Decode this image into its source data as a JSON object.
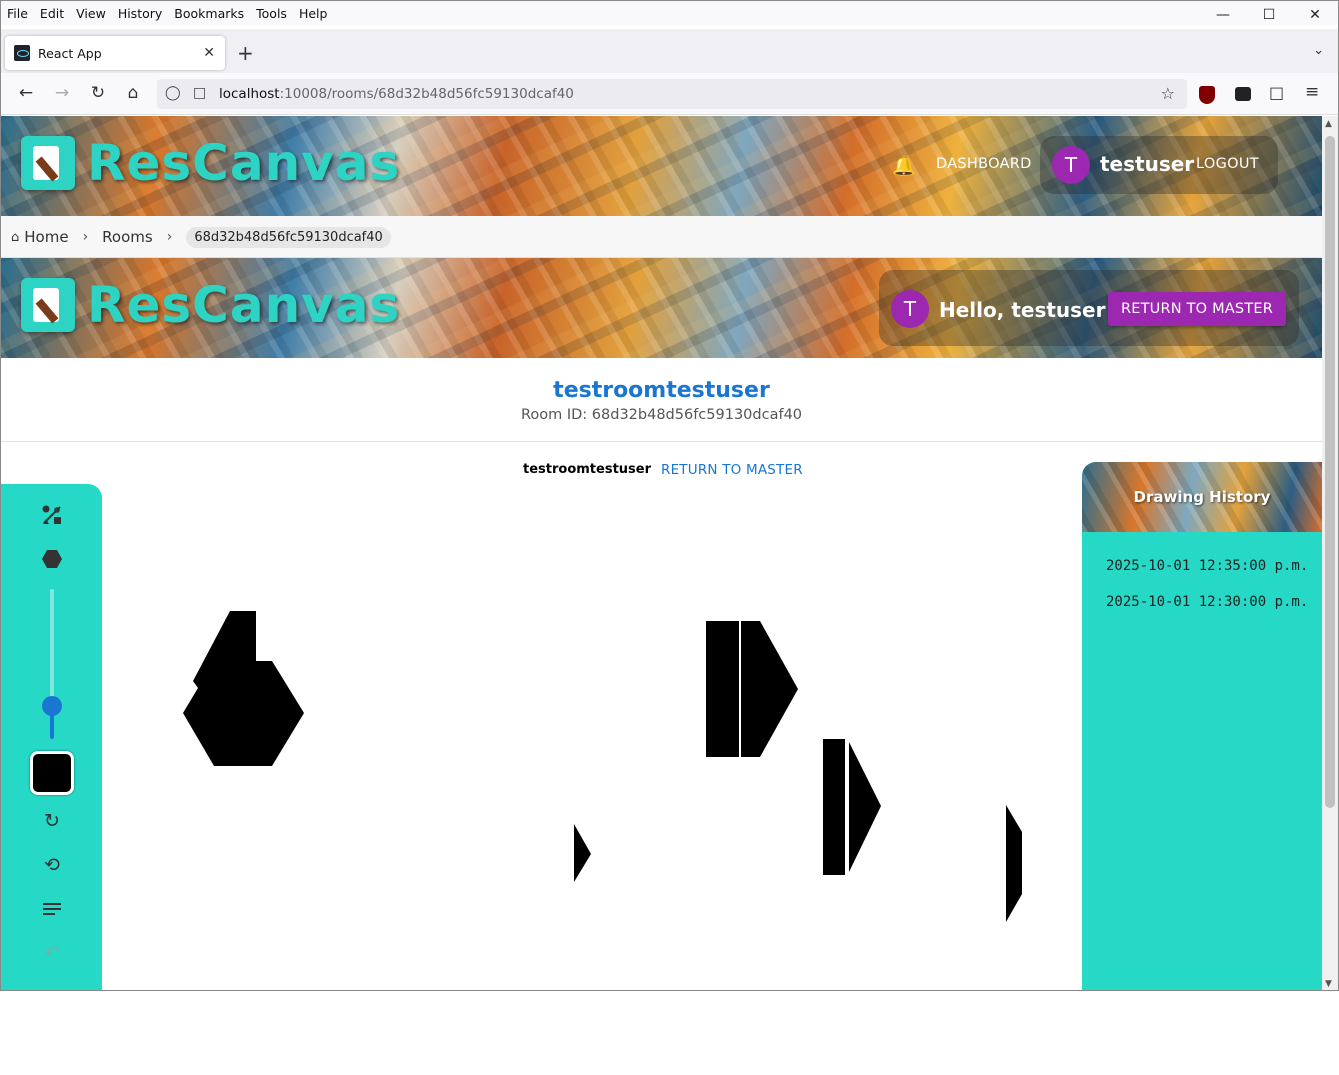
{
  "browser": {
    "menu": [
      "File",
      "Edit",
      "View",
      "History",
      "Bookmarks",
      "Tools",
      "Help"
    ],
    "tab_title": "React App",
    "url_host": "localhost",
    "url_path": ":10008/rooms/68d32b48d56fc59130dcaf40"
  },
  "header": {
    "brand": "ResCanvas",
    "dashboard_label": "DASHBOARD",
    "avatar_initial": "T",
    "username": "testuser",
    "logout_label": "LOGOUT"
  },
  "breadcrumbs": {
    "home": "Home",
    "rooms": "Rooms",
    "current": "68d32b48d56fc59130dcaf40"
  },
  "room_header": {
    "brand": "ResCanvas",
    "avatar_initial": "T",
    "greeting": "Hello, testuser",
    "return_label": "RETURN TO MASTER"
  },
  "room": {
    "name": "testroomtestuser",
    "id_line": "Room ID: 68d32b48d56fc59130dcaf40"
  },
  "canvas_top": {
    "room_name": "testroomtestuser",
    "return_label": "RETURN TO MASTER"
  },
  "toolbar": {
    "icons": [
      "mixed-shapes-icon",
      "hexagon-icon",
      "brush-size-slider",
      "color-swatch",
      "refresh-icon",
      "history-icon",
      "notes-icon",
      "undo-icon"
    ],
    "brush_size_fraction": 0.22,
    "color": "#000000"
  },
  "history": {
    "title": "Drawing History",
    "items": [
      "2025-10-01 12:35:00 p.m.",
      "2025-10-01 12:30:00 p.m."
    ]
  },
  "colors": {
    "accent": "#25d9c6",
    "purple": "#9c27b0",
    "link_blue": "#1976d2"
  }
}
